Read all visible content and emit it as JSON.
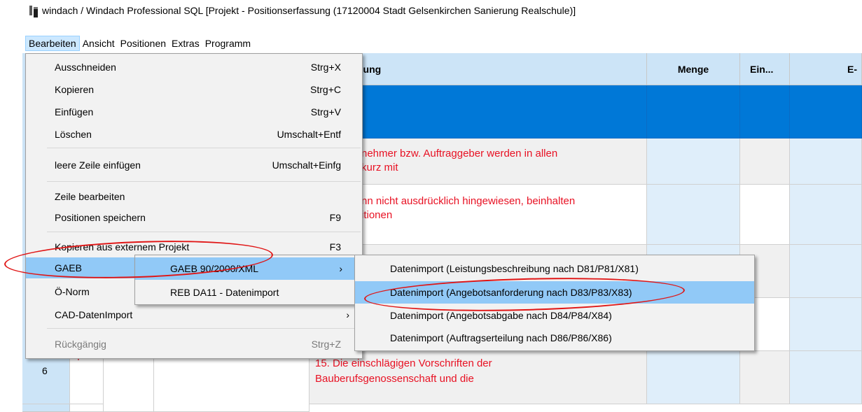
{
  "window": {
    "title": "windach / Windach Professional SQL [Projekt - Positionserfassung (17120004 Stadt Gelsenkirchen Sanierung Realschule)]"
  },
  "menubar": [
    "Bearbeiten",
    "Ansicht",
    "Positionen",
    "Extras",
    "Programm"
  ],
  "grid": {
    "headers": {
      "bezeichnung": "nung",
      "menge": "Menge",
      "einheit": "Ein...",
      "ep": "E-Pr"
    },
    "rows": [
      {
        "text_line1": "nehmer bzw. Auftraggeber werden in allen",
        "text_line2": "kurz mit"
      },
      {
        "text_line1": "nn nicht ausdrücklich hingewiesen, beinhalten",
        "text_line2": "itionen"
      },
      {
        "number": "6",
        "mark": "I",
        "text_line1": "15.  Die einschlägigen Vorschriften der",
        "text_line2": "Bauberufsgenossenschaft und die"
      }
    ]
  },
  "edit_menu": {
    "items": [
      {
        "label": "Ausschneiden",
        "shortcut": "Strg+X"
      },
      {
        "label": "Kopieren",
        "shortcut": "Strg+C"
      },
      {
        "label": "Einfügen",
        "shortcut": "Strg+V"
      },
      {
        "label": "Löschen",
        "shortcut": "Umschalt+Entf"
      },
      {
        "label": "leere Zeile einfügen",
        "shortcut": "Umschalt+Einfg"
      },
      {
        "label": "Zeile bearbeiten",
        "shortcut": ""
      },
      {
        "label": "Positionen speichern",
        "shortcut": "F9"
      },
      {
        "label": "Kopieren aus externem Projekt",
        "shortcut": "F3"
      },
      {
        "label": "GAEB",
        "shortcut": ""
      },
      {
        "label": "Ö-Norm",
        "shortcut": ""
      },
      {
        "label": "CAD-DatenImport",
        "shortcut": ""
      },
      {
        "label": "Rückgängig",
        "shortcut": "Strg+Z"
      }
    ]
  },
  "gaeb_menu": {
    "items": [
      {
        "label": "GAEB 90/2000/XML"
      },
      {
        "label": "REB DA11 - Datenimport"
      }
    ]
  },
  "gaeb_xml_menu": {
    "items": [
      {
        "label": "Datenimport (Leistungsbeschreibung nach D81/P81/X81)"
      },
      {
        "label": "Datenimport (Angebotsanforderung nach D83/P83/X83)"
      },
      {
        "label": "Datenimport (Angebotsabgabe nach D84/P84/X84)"
      },
      {
        "label": "Datenimport (Auftragserteilung nach D86/P86/X86)"
      }
    ]
  },
  "icons": [
    "app-icon",
    "chevron-right-icon"
  ],
  "colors": {
    "header": "#cce4f7",
    "selection": "#0078d7",
    "menu_highlight": "#91c9f7",
    "annotation": "#e01515",
    "red_text": "#e81123"
  }
}
